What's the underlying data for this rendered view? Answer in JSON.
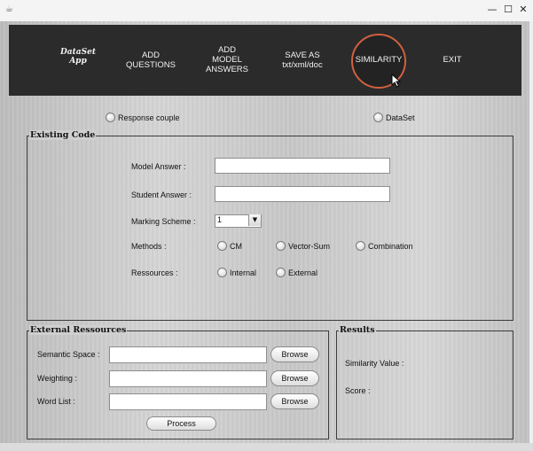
{
  "window": {
    "minimize_glyph": "—",
    "maximize_glyph": "☐",
    "close_glyph": "✕"
  },
  "menu": {
    "logo": "DataSet\nApp",
    "add_questions": "ADD\nQUESTIONS",
    "add_model_answers": "ADD\nMODEL\nANSWERS",
    "save_as": "SAVE AS\ntxt/xml/doc",
    "similarity": "SIMILARITY",
    "exit": "EXIT",
    "active_item": "SIMILARITY",
    "accent_color": "#d0603e"
  },
  "source": {
    "response_couple": "Response couple",
    "dataset": "DataSet"
  },
  "existing_code": {
    "title": "Existing Code",
    "model_answer_label": "Model Answer :",
    "model_answer_value": "",
    "student_answer_label": "Student Answer :",
    "student_answer_value": "",
    "marking_scheme_label": "Marking Scheme :",
    "marking_scheme_value": "1",
    "methods_label": "Methods :",
    "methods": [
      "CM",
      "Vector-Sum",
      "Combination"
    ],
    "ressources_label": "Ressources :",
    "ressources": [
      "Internal",
      "External"
    ]
  },
  "external_ressources": {
    "title": "External Ressources",
    "semantic_space_label": "Semantic Space :",
    "weighting_label": "Weighting :",
    "word_list_label": "Word List :",
    "browse_label": "Browse",
    "process_label": "Process"
  },
  "results": {
    "title": "Results",
    "similarity_value_label": "Similarity Value :",
    "score_label": "Score :"
  }
}
